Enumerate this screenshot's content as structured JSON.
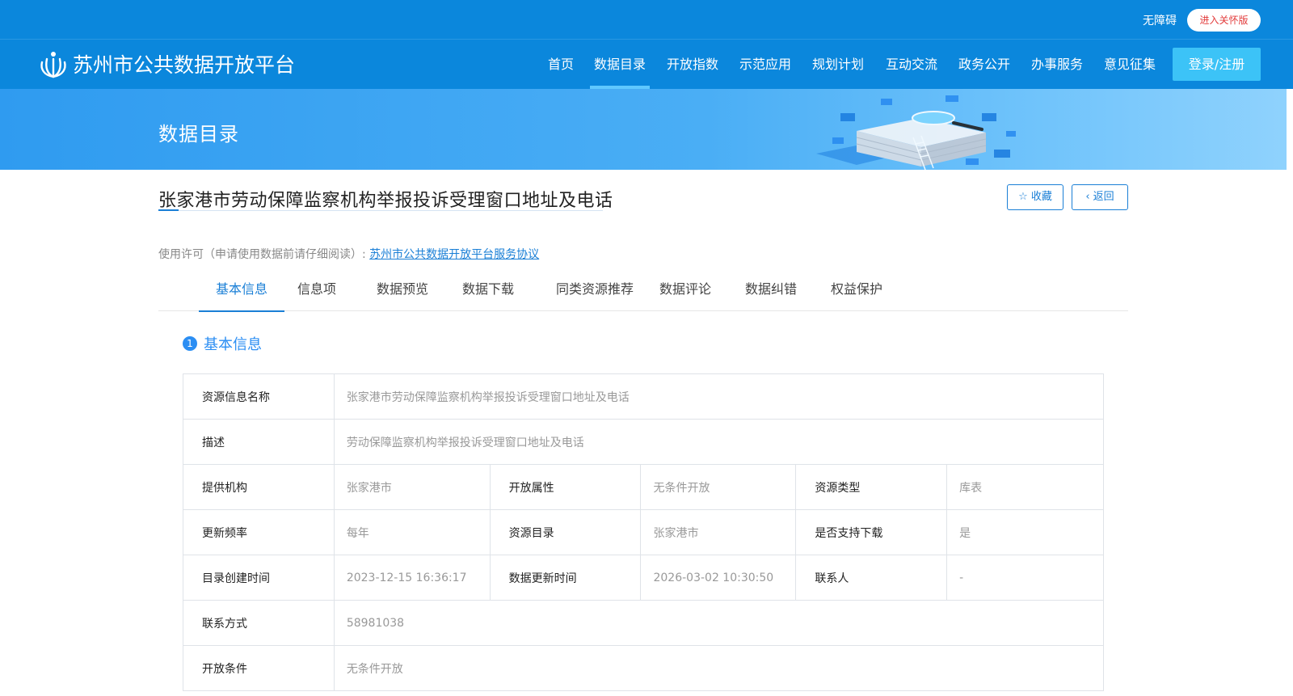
{
  "header": {
    "accessibility_label": "无障碍",
    "care_mode_label": "进入关怀版",
    "site_title": "苏州市公共数据开放平台",
    "login_label": "登录/注册",
    "nav": [
      {
        "label": "首页",
        "active": false
      },
      {
        "label": "数据目录",
        "active": true
      },
      {
        "label": "开放指数",
        "active": false
      },
      {
        "label": "示范应用",
        "active": false
      },
      {
        "label": "规划计划",
        "active": false
      },
      {
        "label": "互动交流",
        "active": false
      },
      {
        "label": "政务公开",
        "active": false
      },
      {
        "label": "办事服务",
        "active": false
      },
      {
        "label": "意见征集",
        "active": false
      }
    ]
  },
  "banner": {
    "title": "数据目录"
  },
  "detail": {
    "title": "张家港市劳动保障监察机构举报投诉受理窗口地址及电话",
    "favorite_label": "收藏",
    "back_label": "返回",
    "license_prefix": "使用许可（申请使用数据前请仔细阅读）: ",
    "license_link": "苏州市公共数据开放平台服务协议"
  },
  "tabs": [
    {
      "label": "基本信息",
      "active": true
    },
    {
      "label": "信息项",
      "active": false
    },
    {
      "label": "数据预览",
      "active": false
    },
    {
      "label": "数据下载",
      "active": false
    },
    {
      "label": "同类资源推荐",
      "active": false
    },
    {
      "label": "数据评论",
      "active": false
    },
    {
      "label": "数据纠错",
      "active": false
    },
    {
      "label": "权益保护",
      "active": false
    }
  ],
  "section": {
    "number": "1",
    "title": "基本信息"
  },
  "info": {
    "resource_name_label": "资源信息名称",
    "resource_name": "张家港市劳动保障监察机构举报投诉受理窗口地址及电话",
    "description_label": "描述",
    "description": "劳动保障监察机构举报投诉受理窗口地址及电话",
    "provider_label": "提供机构",
    "provider": "张家港市",
    "open_attr_label": "开放属性",
    "open_attr": "无条件开放",
    "resource_type_label": "资源类型",
    "resource_type": "库表",
    "update_freq_label": "更新频率",
    "update_freq": "每年",
    "catalog_label": "资源目录",
    "catalog": "张家港市",
    "download_label": "是否支持下载",
    "download": "是",
    "created_label": "目录创建时间",
    "created": "2023-12-15 16:36:17",
    "updated_label": "数据更新时间",
    "updated": "2026-03-02 10:30:50",
    "contact_person_label": "联系人",
    "contact_person": "-",
    "contact_label": "联系方式",
    "contact": "58981038",
    "open_cond_label": "开放条件",
    "open_cond": "无条件开放"
  }
}
